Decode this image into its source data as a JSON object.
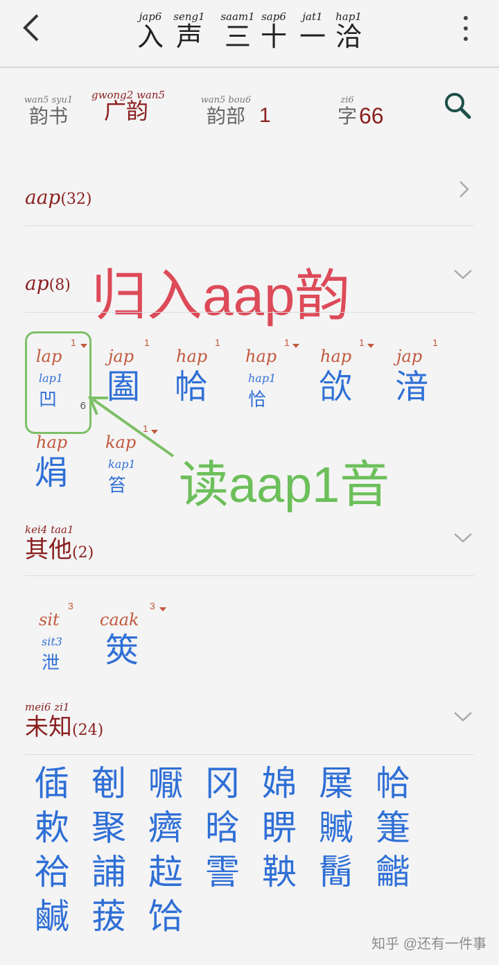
{
  "header": {
    "back_glyph": "<",
    "title": [
      {
        "rom": "jap6",
        "han": "入"
      },
      {
        "rom": "seng1",
        "han": "声"
      },
      {
        "rom": "saam1",
        "han": "三"
      },
      {
        "rom": "sap6",
        "han": "十"
      },
      {
        "rom": "jat1",
        "han": "一"
      },
      {
        "rom": "hap1",
        "han": "洽"
      }
    ]
  },
  "info": {
    "book_rom": "wan5 syu1",
    "book_han": "韵书",
    "name_rom": "gwong2 wan5",
    "name_han": "广韵",
    "part_rom": "wan5 bou6",
    "part_han": "韵部",
    "part_value": "1",
    "count_rom": "zi6",
    "count_han": "字",
    "count_value": "66"
  },
  "sections": {
    "aap": {
      "label": "aap",
      "count": "(32)"
    },
    "ap": {
      "label": "ap",
      "count": "(8)"
    },
    "other": {
      "rom": "kei4 taa1",
      "han": "其他",
      "count": "(2)"
    },
    "unknown": {
      "rom": "mei6 zi1",
      "han": "未知",
      "count": "(24)"
    }
  },
  "ap_chars": [
    {
      "pron": "lap",
      "tone": "1",
      "marked": true,
      "small_rom": "lap1",
      "small_ch": "凹",
      "sub": "6"
    },
    {
      "pron": "jap",
      "tone": "1",
      "marked": false,
      "ch": "圔"
    },
    {
      "pron": "hap",
      "tone": "1",
      "marked": false,
      "ch": "帢"
    },
    {
      "pron": "hap",
      "tone": "1",
      "marked": true,
      "small_rom": "hap1",
      "small_ch": "恰"
    },
    {
      "pron": "hap",
      "tone": "1",
      "marked": true,
      "ch": "欱"
    },
    {
      "pron": "jap",
      "tone": "1",
      "marked": false,
      "ch": "湆"
    },
    {
      "pron": "hap",
      "tone": "",
      "marked": false,
      "ch": "焆"
    },
    {
      "pron": "kap",
      "tone": "1",
      "marked": true,
      "small_rom": "kap1",
      "small_ch": "笞"
    }
  ],
  "other_chars": [
    {
      "pron": "sit",
      "tone": "3",
      "marked": false,
      "small_rom": "sit3",
      "small_ch": "泄"
    },
    {
      "pron": "caak",
      "tone": "3",
      "marked": true,
      "ch": "筴"
    }
  ],
  "unknown_chars": [
    "偛",
    "剦",
    "嚈",
    "冈",
    "婂",
    "屟",
    "帢",
    "欶",
    "聚",
    "癠",
    "晗",
    "睤",
    "贓",
    "箑",
    "祫",
    "誧",
    "趇",
    "霅",
    "鞅",
    "鬝",
    "龤",
    "鹹",
    "菝",
    "饸"
  ],
  "annotations": {
    "red": "归入aap韵",
    "green": "读aap1音"
  },
  "watermark": "知乎 @还有一件事",
  "colors": {
    "accent_red": "#8a1f1f",
    "pron": "#c1583d",
    "char_blue": "#2f6fd6",
    "annot_red": "#dd4a58",
    "annot_green": "#6cbf5a"
  },
  "icons": {
    "back": "chevron-left-icon",
    "more": "more-vertical-icon",
    "search": "search-icon",
    "chevron_right": "chevron-right-icon",
    "chevron_down": "chevron-down-icon"
  }
}
